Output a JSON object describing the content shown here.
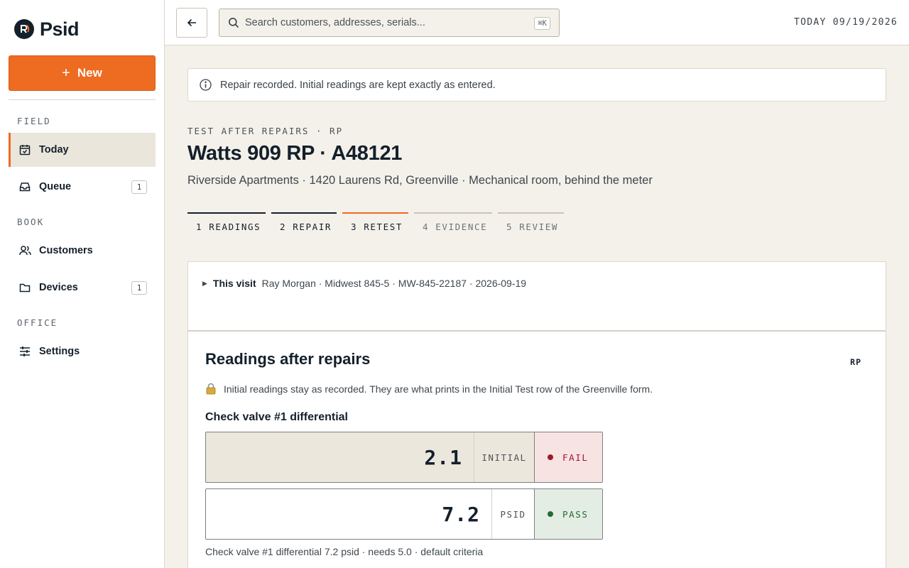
{
  "app": {
    "name": "Psid",
    "new_label": "New",
    "colors": {
      "accent": "#ee6b22",
      "ink": "#14202b",
      "fail": "#9b1b2c",
      "pass": "#216b34"
    }
  },
  "sidebar": {
    "sections": [
      {
        "label": "FIELD",
        "items": [
          {
            "label": "Today",
            "icon": "calendar-check-icon",
            "active": true
          },
          {
            "label": "Queue",
            "icon": "inbox-icon",
            "badge": "1"
          }
        ]
      },
      {
        "label": "BOOK",
        "items": [
          {
            "label": "Customers",
            "icon": "users-icon"
          },
          {
            "label": "Devices",
            "icon": "folder-icon",
            "badge": "1"
          }
        ]
      },
      {
        "label": "OFFICE",
        "items": [
          {
            "label": "Settings",
            "icon": "sliders-icon"
          }
        ]
      }
    ]
  },
  "topbar": {
    "search_placeholder": "Search customers, addresses, serials...",
    "shortcut": "⌘K",
    "today": "TODAY 09/19/2026"
  },
  "notice": "Repair recorded. Initial readings are kept exactly as entered.",
  "page": {
    "eyebrow": "TEST AFTER REPAIRS · RP",
    "title": "Watts 909 RP · A48121",
    "subtitle": "Riverside Apartments · 1420 Laurens Rd, Greenville · Mechanical room, behind the meter"
  },
  "steps": [
    {
      "label": "1 READINGS",
      "state": "done"
    },
    {
      "label": "2 REPAIR",
      "state": "done"
    },
    {
      "label": "3 RETEST",
      "state": "current"
    },
    {
      "label": "4 EVIDENCE",
      "state": "pending"
    },
    {
      "label": "5 REVIEW",
      "state": "pending"
    }
  ],
  "visit": {
    "label": "This visit",
    "details": "Ray Morgan · Midwest 845-5 · MW-845-22187 · 2026-09-19"
  },
  "panel": {
    "title": "Readings after repairs",
    "tag": "RP",
    "lock_note": "Initial readings stay as recorded. They are what prints in the Initial Test row of the Greenville form.",
    "field_label": "Check valve #1 differential",
    "initial": {
      "value": "2.1",
      "unit": "INITIAL",
      "status": "FAIL"
    },
    "retest": {
      "value": "7.2",
      "unit": "PSID",
      "status": "PASS"
    },
    "criteria": "Check valve #1 differential 7.2 psid · needs 5.0 · default criteria"
  }
}
